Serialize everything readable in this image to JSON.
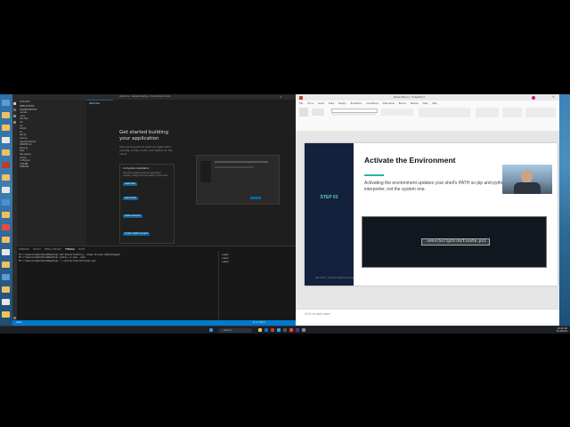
{
  "vscode": {
    "title": "Welcome - Shared Desktop - Visual Studio Code",
    "editor_tab": "Welcome",
    "explorer_title": "EXPLORER",
    "explorer_items": [
      "OPEN EDITORS",
      "SHAREDDESKTOP",
      ".vscode",
      ".venv",
      "add_files",
      "doc",
      "Lib",
      "Scripts",
      "src",
      "app.py",
      "main.py",
      "requirements.txt",
      "README.md",
      "setup.py",
      "tests",
      "test_app.py",
      "utils.py",
      "config.json",
      "OUTLINE",
      "TIMELINE"
    ],
    "guide": {
      "title": "Get started building your application",
      "text": "Use quick guide to build an application visually, locally build, and deploy to the cloud",
      "section": "Complete installation",
      "buttons": [
        "Install SDK",
        "Open folder",
        "Install extension",
        "Create a Python project"
      ]
    },
    "panel_tabs": [
      "PROBLEMS",
      "OUTPUT",
      "DEBUG CONSOLE",
      "TERMINAL",
      "PORTS"
    ],
    "terminal_lines": [
      "PS C:\\Users\\temp\\SharedDesktop> Set-ExecutionPolicy -Scope Process RemoteSigned",
      "PS C:\\Users\\temp\\SharedDesktop> python -m venv .venv",
      "PS C:\\Users\\temp\\SharedDesktop> .\\.venv\\Scripts\\Activate.ps1"
    ],
    "status_left": "main",
    "status_right": "Ln 1, Col 1"
  },
  "ppt": {
    "title": "Presentation1 - PowerPoint",
    "ribbon_tabs": [
      "File",
      "Home",
      "Insert",
      "Draw",
      "Design",
      "Transitions",
      "Animations",
      "Slide Show",
      "Record",
      "Review",
      "View",
      "Help"
    ],
    "slide": {
      "step": "STEP 03",
      "title": "Activate the Environment",
      "body": "Activating the environment updates your shell's PATH so pip and python point to the isolated interpreter, not the system one.",
      "code": ".venv\\Scripts\\Activate.ps1",
      "footer": "AIE 1001 | Shared Desktop Setup"
    },
    "notes_placeholder": "Click to add notes"
  },
  "taskbar": {
    "search": "Search",
    "time": "10:42 AM",
    "date": "5/14/2025"
  }
}
